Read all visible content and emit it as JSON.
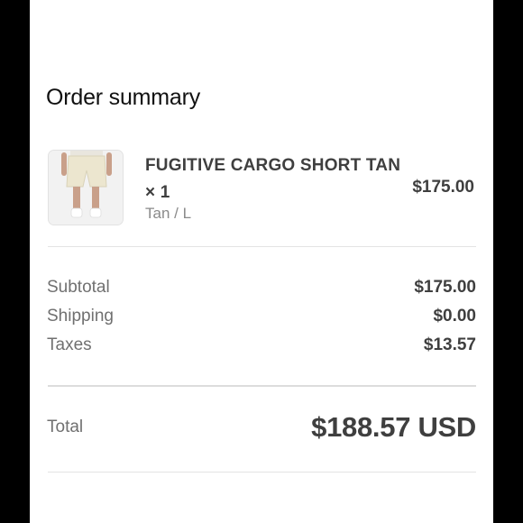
{
  "order_summary": {
    "title": "Order summary",
    "item": {
      "name": "FUGITIVE CARGO SHORT TAN × 1",
      "variant": "Tan / L",
      "price": "$175.00"
    },
    "subtotal": {
      "label": "Subtotal",
      "value": "$175.00"
    },
    "shipping": {
      "label": "Shipping",
      "value": "$0.00"
    },
    "taxes": {
      "label": "Taxes",
      "value": "$13.57"
    },
    "total": {
      "label": "Total",
      "value": "$188.57 USD"
    }
  }
}
